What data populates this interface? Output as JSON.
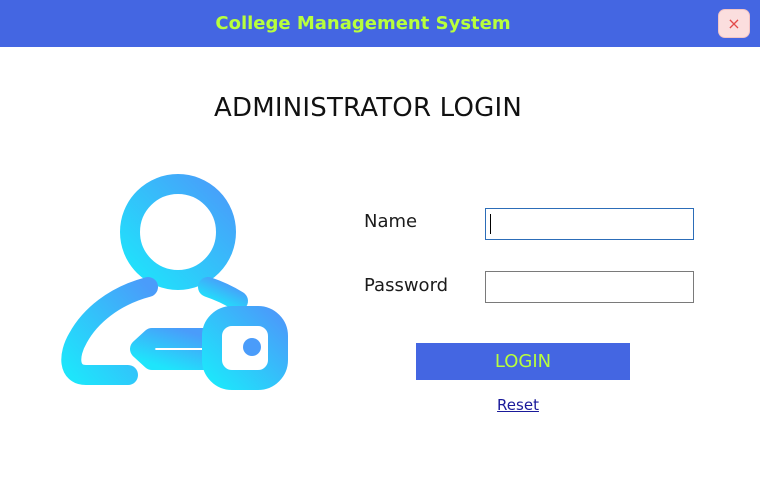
{
  "window": {
    "title": "College Management System",
    "close_glyph": "×",
    "colors": {
      "titlebar": "#4466e2",
      "title_text": "#b8ff3c",
      "close_bg": "#fbdede",
      "close_glyph": "#e24a4a"
    }
  },
  "login": {
    "heading": "ADMINISTRATOR LOGIN",
    "logo_icon": "user-key-icon",
    "name_label": "Name",
    "name_value": "",
    "password_label": "Password",
    "password_value": "",
    "login_button": "LOGIN",
    "reset_link": "Reset",
    "colors": {
      "button_bg": "#4466e2",
      "button_text": "#b8ff3c",
      "icon_light": "#1ee5fb",
      "icon_dark": "#4a9cfa",
      "link": "#1a1a9a"
    }
  }
}
